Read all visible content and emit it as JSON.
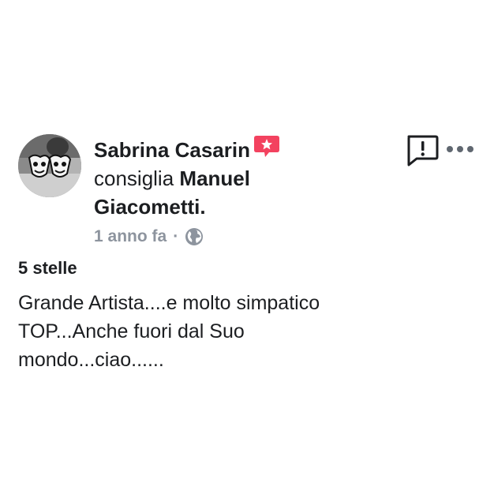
{
  "post": {
    "author_name": "Sabrina Casarin",
    "verb": "consiglia",
    "page_name": "Manuel Giacometti.",
    "timestamp": "1 anno fa",
    "separator": "·",
    "privacy_icon": "globe-icon",
    "recommendation_badge_icon": "star-speech-bubble-icon",
    "report_icon": "report-exclamation-icon",
    "more_icon": "more-dots-icon",
    "rating_label": "5 stelle",
    "review_text": "Grande Artista....e molto simpatico\nTOP...Anche fuori dal Suo\nmondo...ciao......"
  },
  "colors": {
    "text_primary": "#1c1e21",
    "text_secondary": "#8d949e",
    "badge_red": "#f3425f"
  }
}
